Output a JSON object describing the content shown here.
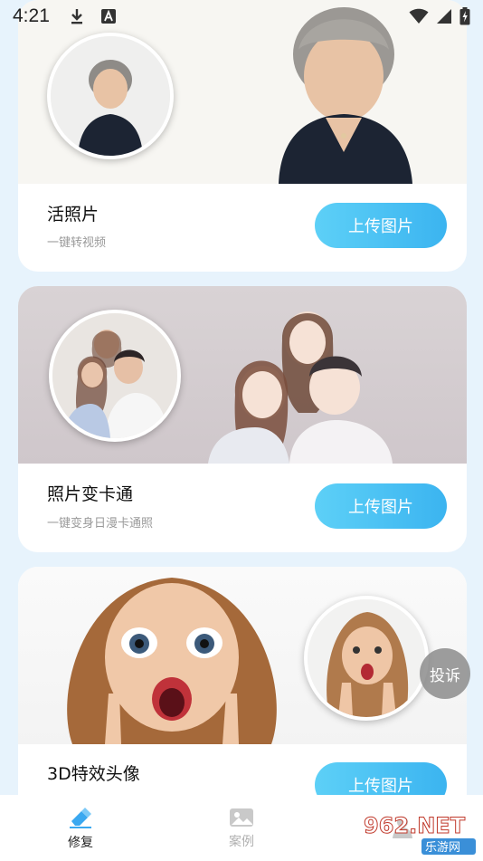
{
  "status_bar": {
    "time": "4:21",
    "icons": [
      "download-icon",
      "text-a-icon",
      "wifi-icon",
      "signal-icon",
      "battery-charging-icon"
    ]
  },
  "cards": [
    {
      "title": "活照片",
      "subtitle": "一键转视频",
      "button": "上传图片"
    },
    {
      "title": "照片变卡通",
      "subtitle": "一键变身日漫卡通照",
      "button": "上传图片"
    },
    {
      "title": "3D特效头像",
      "subtitle": "",
      "button": "上传图片"
    }
  ],
  "floating": {
    "complaint": "投诉"
  },
  "bottom_nav": [
    {
      "label": "修复",
      "icon": "eraser-icon",
      "active": true
    },
    {
      "label": "案例",
      "icon": "image-icon",
      "active": false
    },
    {
      "label": "",
      "icon": "person-icon",
      "active": false
    }
  ],
  "watermark": {
    "main": "962.NET",
    "sub": "乐游网"
  },
  "colors": {
    "accent": "#3bb4f0",
    "accent_light": "#5dd0f7",
    "page_bg": "#e7f3fc",
    "active_icon": "#3aa8f0"
  }
}
